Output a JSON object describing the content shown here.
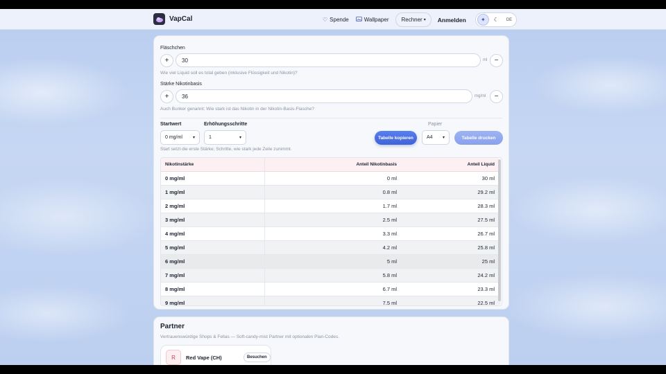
{
  "header": {
    "brand": "VapCal",
    "nav": {
      "donate": "Spende",
      "wallpaper": "Wallpaper",
      "calculator": "Rechner",
      "login": "Anmelden",
      "language": "DE"
    }
  },
  "form": {
    "bottle": {
      "label": "Fläschchen",
      "value": "30",
      "unit": "ml",
      "hint": "Wie viel Liquid soll es total geben (inklusive Flüssigkeit und Nikotin)?"
    },
    "base": {
      "label": "Stärke Nikotinbasis",
      "value": "36",
      "unit": "mg/ml",
      "hint": "Auch Bunker genannt: Wie stark ist das Nikotin in der Nikotin-Basis-Flasche?"
    },
    "start": {
      "label": "Startwert",
      "value": "0 mg/ml"
    },
    "step": {
      "label": "Erhöhungsschritte",
      "value": "1"
    },
    "controls_hint": "Start setzt die erste Stärke; Schritte, wie stark jede Zeile zunimmt.",
    "copy_button": "Tabelle kopieren",
    "paper": {
      "label": "Papier",
      "value": "A4"
    },
    "print_button": "Tabelle drucken"
  },
  "table": {
    "headers": [
      "Nikotinstärke",
      "Anteil Nikotinbasis",
      "Anteil Liquid"
    ],
    "rows": [
      [
        "0 mg/ml",
        "0 ml",
        "30 ml"
      ],
      [
        "1 mg/ml",
        "0.8 ml",
        "29.2 ml"
      ],
      [
        "2 mg/ml",
        "1.7 ml",
        "28.3 ml"
      ],
      [
        "3 mg/ml",
        "2.5 ml",
        "27.5 ml"
      ],
      [
        "4 mg/ml",
        "3.3 ml",
        "26.7 ml"
      ],
      [
        "5 mg/ml",
        "4.2 ml",
        "25.8 ml"
      ],
      [
        "6 mg/ml",
        "5 ml",
        "25 ml"
      ],
      [
        "7 mg/ml",
        "5.8 ml",
        "24.2 ml"
      ],
      [
        "8 mg/ml",
        "6.7 ml",
        "23.3 ml"
      ],
      [
        "9 mg/ml",
        "7.5 ml",
        "22.5 ml"
      ]
    ]
  },
  "partner": {
    "title": "Partner",
    "subtitle": "Vertrauenswürdige Shops & Fellas — Soft-candy-mist Partner mit optionalen Plan-Codes.",
    "shops": [
      {
        "initial": "R",
        "name": "Red Vape (CH)",
        "button": "Besuchen"
      }
    ]
  },
  "icons": {
    "heart": "heart-icon",
    "image": "image-icon",
    "sun": "sun-icon",
    "moon": "moon-icon",
    "chevron": "chevron-down-icon"
  },
  "colors": {
    "accent": "#4a6ee0",
    "table_header_bg": "#fdf0f3",
    "partner_initial": "#c0485f"
  }
}
